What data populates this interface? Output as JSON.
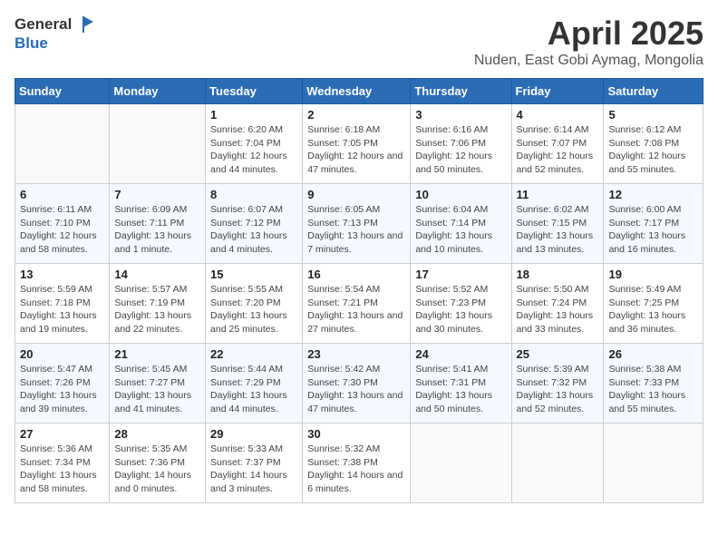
{
  "header": {
    "logo_general": "General",
    "logo_blue": "Blue",
    "title": "April 2025",
    "subtitle": "Nuden, East Gobi Aymag, Mongolia"
  },
  "days_of_week": [
    "Sunday",
    "Monday",
    "Tuesday",
    "Wednesday",
    "Thursday",
    "Friday",
    "Saturday"
  ],
  "weeks": [
    [
      {
        "day": "",
        "sunrise": "",
        "sunset": "",
        "daylight": ""
      },
      {
        "day": "",
        "sunrise": "",
        "sunset": "",
        "daylight": ""
      },
      {
        "day": "1",
        "sunrise": "Sunrise: 6:20 AM",
        "sunset": "Sunset: 7:04 PM",
        "daylight": "Daylight: 12 hours and 44 minutes."
      },
      {
        "day": "2",
        "sunrise": "Sunrise: 6:18 AM",
        "sunset": "Sunset: 7:05 PM",
        "daylight": "Daylight: 12 hours and 47 minutes."
      },
      {
        "day": "3",
        "sunrise": "Sunrise: 6:16 AM",
        "sunset": "Sunset: 7:06 PM",
        "daylight": "Daylight: 12 hours and 50 minutes."
      },
      {
        "day": "4",
        "sunrise": "Sunrise: 6:14 AM",
        "sunset": "Sunset: 7:07 PM",
        "daylight": "Daylight: 12 hours and 52 minutes."
      },
      {
        "day": "5",
        "sunrise": "Sunrise: 6:12 AM",
        "sunset": "Sunset: 7:08 PM",
        "daylight": "Daylight: 12 hours and 55 minutes."
      }
    ],
    [
      {
        "day": "6",
        "sunrise": "Sunrise: 6:11 AM",
        "sunset": "Sunset: 7:10 PM",
        "daylight": "Daylight: 12 hours and 58 minutes."
      },
      {
        "day": "7",
        "sunrise": "Sunrise: 6:09 AM",
        "sunset": "Sunset: 7:11 PM",
        "daylight": "Daylight: 13 hours and 1 minute."
      },
      {
        "day": "8",
        "sunrise": "Sunrise: 6:07 AM",
        "sunset": "Sunset: 7:12 PM",
        "daylight": "Daylight: 13 hours and 4 minutes."
      },
      {
        "day": "9",
        "sunrise": "Sunrise: 6:05 AM",
        "sunset": "Sunset: 7:13 PM",
        "daylight": "Daylight: 13 hours and 7 minutes."
      },
      {
        "day": "10",
        "sunrise": "Sunrise: 6:04 AM",
        "sunset": "Sunset: 7:14 PM",
        "daylight": "Daylight: 13 hours and 10 minutes."
      },
      {
        "day": "11",
        "sunrise": "Sunrise: 6:02 AM",
        "sunset": "Sunset: 7:15 PM",
        "daylight": "Daylight: 13 hours and 13 minutes."
      },
      {
        "day": "12",
        "sunrise": "Sunrise: 6:00 AM",
        "sunset": "Sunset: 7:17 PM",
        "daylight": "Daylight: 13 hours and 16 minutes."
      }
    ],
    [
      {
        "day": "13",
        "sunrise": "Sunrise: 5:59 AM",
        "sunset": "Sunset: 7:18 PM",
        "daylight": "Daylight: 13 hours and 19 minutes."
      },
      {
        "day": "14",
        "sunrise": "Sunrise: 5:57 AM",
        "sunset": "Sunset: 7:19 PM",
        "daylight": "Daylight: 13 hours and 22 minutes."
      },
      {
        "day": "15",
        "sunrise": "Sunrise: 5:55 AM",
        "sunset": "Sunset: 7:20 PM",
        "daylight": "Daylight: 13 hours and 25 minutes."
      },
      {
        "day": "16",
        "sunrise": "Sunrise: 5:54 AM",
        "sunset": "Sunset: 7:21 PM",
        "daylight": "Daylight: 13 hours and 27 minutes."
      },
      {
        "day": "17",
        "sunrise": "Sunrise: 5:52 AM",
        "sunset": "Sunset: 7:23 PM",
        "daylight": "Daylight: 13 hours and 30 minutes."
      },
      {
        "day": "18",
        "sunrise": "Sunrise: 5:50 AM",
        "sunset": "Sunset: 7:24 PM",
        "daylight": "Daylight: 13 hours and 33 minutes."
      },
      {
        "day": "19",
        "sunrise": "Sunrise: 5:49 AM",
        "sunset": "Sunset: 7:25 PM",
        "daylight": "Daylight: 13 hours and 36 minutes."
      }
    ],
    [
      {
        "day": "20",
        "sunrise": "Sunrise: 5:47 AM",
        "sunset": "Sunset: 7:26 PM",
        "daylight": "Daylight: 13 hours and 39 minutes."
      },
      {
        "day": "21",
        "sunrise": "Sunrise: 5:45 AM",
        "sunset": "Sunset: 7:27 PM",
        "daylight": "Daylight: 13 hours and 41 minutes."
      },
      {
        "day": "22",
        "sunrise": "Sunrise: 5:44 AM",
        "sunset": "Sunset: 7:29 PM",
        "daylight": "Daylight: 13 hours and 44 minutes."
      },
      {
        "day": "23",
        "sunrise": "Sunrise: 5:42 AM",
        "sunset": "Sunset: 7:30 PM",
        "daylight": "Daylight: 13 hours and 47 minutes."
      },
      {
        "day": "24",
        "sunrise": "Sunrise: 5:41 AM",
        "sunset": "Sunset: 7:31 PM",
        "daylight": "Daylight: 13 hours and 50 minutes."
      },
      {
        "day": "25",
        "sunrise": "Sunrise: 5:39 AM",
        "sunset": "Sunset: 7:32 PM",
        "daylight": "Daylight: 13 hours and 52 minutes."
      },
      {
        "day": "26",
        "sunrise": "Sunrise: 5:38 AM",
        "sunset": "Sunset: 7:33 PM",
        "daylight": "Daylight: 13 hours and 55 minutes."
      }
    ],
    [
      {
        "day": "27",
        "sunrise": "Sunrise: 5:36 AM",
        "sunset": "Sunset: 7:34 PM",
        "daylight": "Daylight: 13 hours and 58 minutes."
      },
      {
        "day": "28",
        "sunrise": "Sunrise: 5:35 AM",
        "sunset": "Sunset: 7:36 PM",
        "daylight": "Daylight: 14 hours and 0 minutes."
      },
      {
        "day": "29",
        "sunrise": "Sunrise: 5:33 AM",
        "sunset": "Sunset: 7:37 PM",
        "daylight": "Daylight: 14 hours and 3 minutes."
      },
      {
        "day": "30",
        "sunrise": "Sunrise: 5:32 AM",
        "sunset": "Sunset: 7:38 PM",
        "daylight": "Daylight: 14 hours and 6 minutes."
      },
      {
        "day": "",
        "sunrise": "",
        "sunset": "",
        "daylight": ""
      },
      {
        "day": "",
        "sunrise": "",
        "sunset": "",
        "daylight": ""
      },
      {
        "day": "",
        "sunrise": "",
        "sunset": "",
        "daylight": ""
      }
    ]
  ]
}
